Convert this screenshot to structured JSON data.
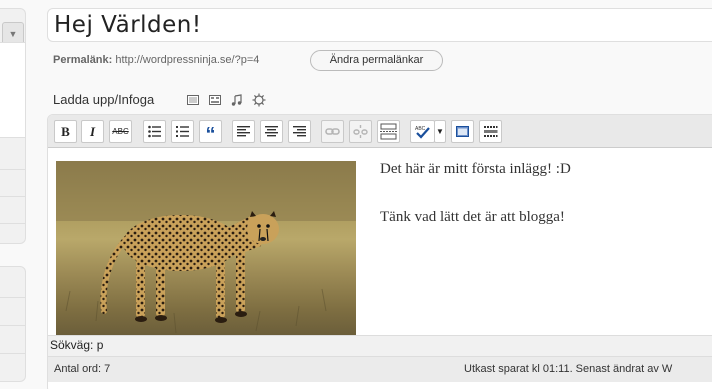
{
  "post": {
    "title": "Hej Världen!",
    "permalink_label": "Permalänk:",
    "permalink_url": "http://wordpressninja.se/?p=4",
    "change_permalinks_button": "Ändra permalänkar"
  },
  "media": {
    "upload_label": "Ladda upp/Infoga",
    "icons": [
      "image-icon",
      "video-icon",
      "audio-icon",
      "media-icon"
    ]
  },
  "toolbar": {
    "bold": "B",
    "italic": "I",
    "strikethrough": "ABC",
    "buttons": [
      "bold",
      "italic",
      "strikethrough",
      "unordered-list",
      "ordered-list",
      "blockquote",
      "align-left",
      "align-center",
      "align-right",
      "link",
      "unlink",
      "insert-more",
      "spellcheck",
      "fullscreen",
      "kitchen-sink"
    ]
  },
  "content": {
    "paragraph1": "Det här är mitt första inlägg! :D",
    "paragraph2": "Tänk vad lätt det är att blogga!",
    "image_subject": "cheetah"
  },
  "path": {
    "label": "Sökväg: p"
  },
  "status": {
    "word_count": "Antal ord: 7",
    "draft_saved": "Utkast sparat kl 01:11. Senast ändrat av W"
  },
  "colors": {
    "background": "#f9f9f9",
    "toolbar": "#e9e9e9",
    "border": "#dfdfdf"
  }
}
